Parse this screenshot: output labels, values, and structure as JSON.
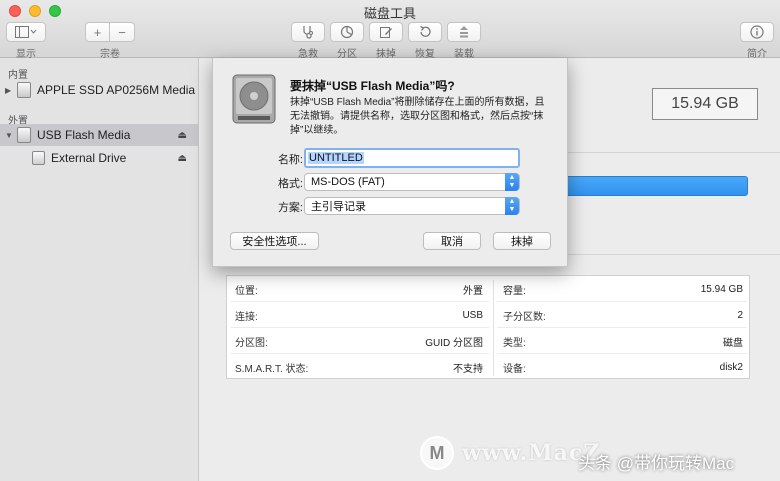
{
  "window": {
    "title": "磁盘工具"
  },
  "toolbar": {
    "view_label": "显示",
    "volume_label": "宗卷",
    "add_symbol": "+",
    "remove_symbol": "−",
    "actions": [
      {
        "id": "first-aid",
        "label": "急救",
        "icon": "stethoscope-icon"
      },
      {
        "id": "partition",
        "label": "分区",
        "icon": "pie-icon"
      },
      {
        "id": "erase",
        "label": "抹掉",
        "icon": "pencil-icon"
      },
      {
        "id": "restore",
        "label": "恢复",
        "icon": "restore-icon"
      },
      {
        "id": "mount",
        "label": "装载",
        "icon": "mount-icon"
      }
    ],
    "info_label": "简介"
  },
  "sidebar": {
    "internal_header": "内置",
    "external_header": "外置",
    "internal_disk": "APPLE SSD AP0256M Media",
    "external_disk": "USB Flash Media",
    "external_volume": "External Drive"
  },
  "main": {
    "capacity": "15.94 GB",
    "info": {
      "left": [
        {
          "k": "位置:",
          "v": "外置"
        },
        {
          "k": "连接:",
          "v": "USB"
        },
        {
          "k": "分区图:",
          "v": "GUID 分区图"
        },
        {
          "k": "S.M.A.R.T. 状态:",
          "v": "不支持"
        }
      ],
      "right": [
        {
          "k": "容量:",
          "v": "15.94 GB"
        },
        {
          "k": "子分区数:",
          "v": "2"
        },
        {
          "k": "类型:",
          "v": "磁盘"
        },
        {
          "k": "设备:",
          "v": "disk2"
        }
      ]
    }
  },
  "dialog": {
    "title": "要抹掉“USB Flash Media”吗?",
    "description": "抹掉“USB Flash Media”将删除储存在上面的所有数据，且无法撤销。请提供名称，选取分区图和格式，然后点按“抹掉”以继续。",
    "name_label": "名称:",
    "name_value": "UNTITLED",
    "format_label": "格式:",
    "format_value": "MS-DOS (FAT)",
    "scheme_label": "方案:",
    "scheme_value": "主引导记录",
    "security_button": "安全性选项...",
    "cancel_button": "取消",
    "erase_button": "抹掉"
  },
  "watermark": {
    "logo_letter": "M",
    "site_text": "www.MacZ",
    "credit": "头条 @带你玩转Mac"
  },
  "colors": {
    "accent": "#2f93ef",
    "selection": "#c8c8cc"
  }
}
